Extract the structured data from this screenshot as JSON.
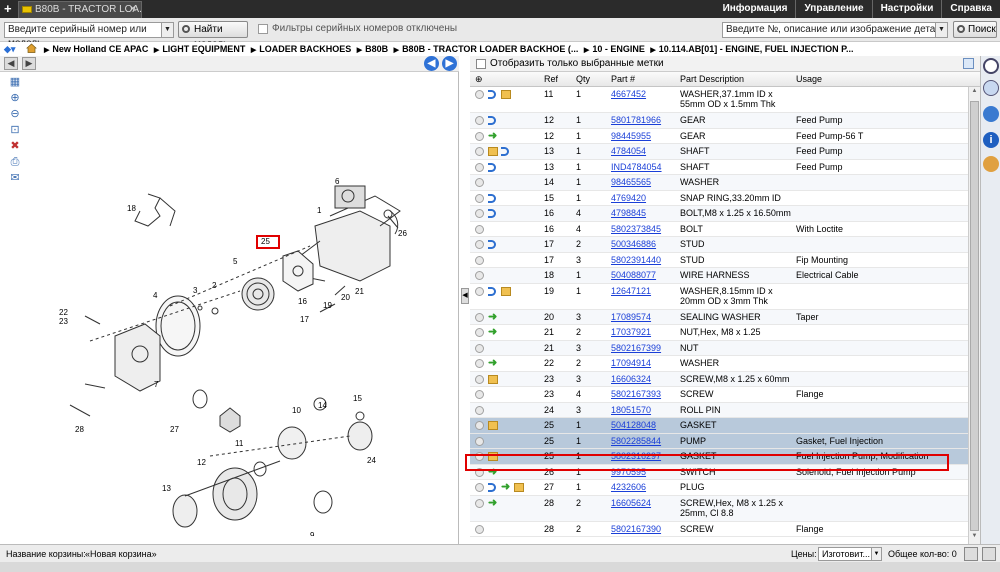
{
  "app": {
    "tab_title": "B80B - TRACTOR LOA...",
    "topnav": [
      "Информация",
      "Управление",
      "Настройки",
      "Справка"
    ]
  },
  "toolbar": {
    "serial_placeholder": "Введите серийный номер или модель",
    "find_model_label": "Найти модель",
    "filter_label": "Фильтры серийных номеров отключены",
    "search_placeholder": "Введите №, описание или изображение детали",
    "search_label": "Поиск"
  },
  "breadcrumb": [
    "New Holland CE APAC",
    "LIGHT EQUIPMENT",
    "LOADER BACKHOES",
    "B80B",
    "B80B - TRACTOR LOADER BACKHOE (...",
    "10 - ENGINE",
    "10.114.AB[01] - ENGINE, FUEL INJECTION P..."
  ],
  "diagram": {
    "callouts": [
      "1",
      "2",
      "3",
      "4",
      "5",
      "6",
      "7",
      "8",
      "9",
      "10",
      "11",
      "12",
      "13",
      "14",
      "15",
      "16",
      "17",
      "18",
      "19",
      "20",
      "21",
      "22",
      "23",
      "24",
      "25",
      "26",
      "27",
      "28"
    ],
    "highlighted_callout": "25"
  },
  "parts_panel": {
    "show_selected_label": "Отобразить только выбранные метки",
    "columns": [
      "Ref",
      "Qty",
      "Part #",
      "Part Description",
      "Usage"
    ],
    "rows": [
      {
        "ref": "11",
        "qty": "1",
        "part": "4667452",
        "desc": "WASHER,37.1mm ID x 55mm OD x 1.5mm Thk",
        "usage": "",
        "icons": [
          "blue",
          "box"
        ],
        "state": ""
      },
      {
        "ref": "12",
        "qty": "1",
        "part": "5801781966",
        "desc": "GEAR",
        "usage": "Feed Pump",
        "icons": [
          "blue"
        ],
        "state": ""
      },
      {
        "ref": "12",
        "qty": "1",
        "part": "98445955",
        "desc": "GEAR",
        "usage": "Feed Pump-56 T",
        "icons": [
          "green"
        ],
        "state": ""
      },
      {
        "ref": "13",
        "qty": "1",
        "part": "4784054",
        "desc": "SHAFT",
        "usage": "Feed Pump",
        "icons": [
          "box",
          "blue"
        ],
        "state": ""
      },
      {
        "ref": "13",
        "qty": "1",
        "part": "IND4784054",
        "desc": "SHAFT",
        "usage": "Feed Pump",
        "icons": [
          "blue"
        ],
        "state": ""
      },
      {
        "ref": "14",
        "qty": "1",
        "part": "98465565",
        "desc": "WASHER",
        "usage": "",
        "icons": [],
        "state": ""
      },
      {
        "ref": "15",
        "qty": "1",
        "part": "4769420",
        "desc": "SNAP RING,33.20mm ID",
        "usage": "",
        "icons": [
          "blue"
        ],
        "state": ""
      },
      {
        "ref": "16",
        "qty": "4",
        "part": "4798845",
        "desc": "BOLT,M8 x 1.25 x 16.50mm",
        "usage": "",
        "icons": [
          "blue"
        ],
        "state": ""
      },
      {
        "ref": "16",
        "qty": "4",
        "part": "5802373845",
        "desc": "BOLT",
        "usage": "With Loctite",
        "icons": [],
        "state": ""
      },
      {
        "ref": "17",
        "qty": "2",
        "part": "500346886",
        "desc": "STUD",
        "usage": "",
        "icons": [
          "blue"
        ],
        "state": ""
      },
      {
        "ref": "17",
        "qty": "3",
        "part": "5802391440",
        "desc": "STUD",
        "usage": "Fip Mounting",
        "icons": [],
        "state": ""
      },
      {
        "ref": "18",
        "qty": "1",
        "part": "504088077",
        "desc": "WIRE HARNESS",
        "usage": "Electrical Cable",
        "icons": [],
        "state": ""
      },
      {
        "ref": "19",
        "qty": "1",
        "part": "12647121",
        "desc": "WASHER,8.15mm ID x 20mm OD x 3mm Thk",
        "usage": "",
        "icons": [
          "blue",
          "box"
        ],
        "state": ""
      },
      {
        "ref": "20",
        "qty": "3",
        "part": "17089574",
        "desc": "SEALING WASHER",
        "usage": "Taper",
        "icons": [
          "green"
        ],
        "state": ""
      },
      {
        "ref": "21",
        "qty": "2",
        "part": "17037921",
        "desc": "NUT,Hex, M8 x 1.25",
        "usage": "",
        "icons": [
          "green"
        ],
        "state": ""
      },
      {
        "ref": "21",
        "qty": "3",
        "part": "5802167399",
        "desc": "NUT",
        "usage": "",
        "icons": [],
        "state": ""
      },
      {
        "ref": "22",
        "qty": "2",
        "part": "17094914",
        "desc": "WASHER",
        "usage": "",
        "icons": [
          "green"
        ],
        "state": ""
      },
      {
        "ref": "23",
        "qty": "3",
        "part": "16606324",
        "desc": "SCREW,M8 x 1.25 x 60mm",
        "usage": "",
        "icons": [
          "box"
        ],
        "state": ""
      },
      {
        "ref": "23",
        "qty": "4",
        "part": "5802167393",
        "desc": "SCREW",
        "usage": "Flange",
        "icons": [],
        "state": ""
      },
      {
        "ref": "24",
        "qty": "3",
        "part": "18051570",
        "desc": "ROLL PIN",
        "usage": "",
        "icons": [],
        "state": ""
      },
      {
        "ref": "25",
        "qty": "1",
        "part": "504128048",
        "desc": "GASKET",
        "usage": "",
        "icons": [
          "box"
        ],
        "state": "sel"
      },
      {
        "ref": "25",
        "qty": "1",
        "part": "5802285844",
        "desc": "PUMP",
        "usage": "Gasket, Fuel Injection",
        "icons": [],
        "state": "sel"
      },
      {
        "ref": "25",
        "qty": "1",
        "part": "5802316297",
        "desc": "GASKET",
        "usage": "Fuel Injection Pump, Modification",
        "icons": [
          "box"
        ],
        "state": "sel"
      },
      {
        "ref": "26",
        "qty": "1",
        "part": "9970595",
        "desc": "SWITCH",
        "usage": "Solenoid, Fuel Injection Pump",
        "icons": [
          "green"
        ],
        "state": ""
      },
      {
        "ref": "27",
        "qty": "1",
        "part": "4232606",
        "desc": "PLUG",
        "usage": "",
        "icons": [
          "blue",
          "green",
          "box"
        ],
        "state": ""
      },
      {
        "ref": "28",
        "qty": "2",
        "part": "16605624",
        "desc": "SCREW,Hex, M8 x 1.25 x 25mm, Cl 8.8",
        "usage": "",
        "icons": [
          "green"
        ],
        "state": ""
      },
      {
        "ref": "28",
        "qty": "2",
        "part": "5802167390",
        "desc": "SCREW",
        "usage": "Flange",
        "icons": [],
        "state": ""
      }
    ]
  },
  "footer": {
    "cart_label": "Название корзины:",
    "cart_value": "«Новая корзина»",
    "price_label": "Цены:",
    "price_value": "Изготовит...",
    "total_label": "Общее кол-во: 0"
  },
  "colors": {
    "topbar": "#2b2b2b",
    "selected_row": "#b8c9db",
    "highlight": "#e00000",
    "link": "#1a3fd8"
  }
}
